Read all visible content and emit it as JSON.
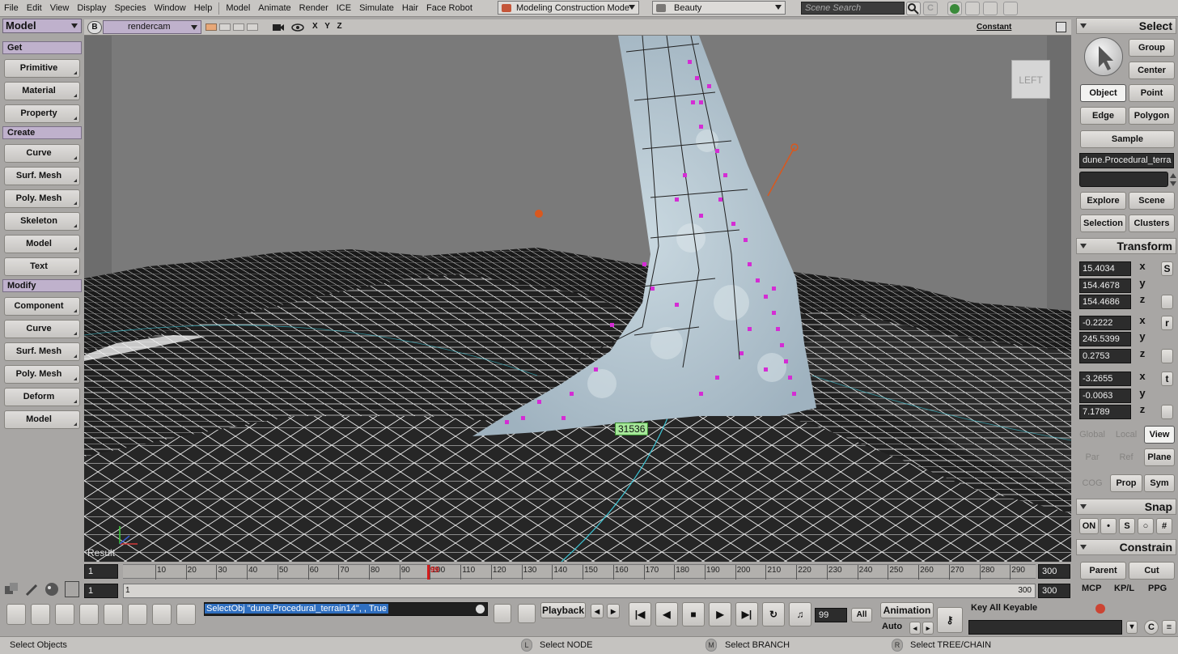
{
  "menubar": {
    "items": [
      "File",
      "Edit",
      "View",
      "Display",
      "Species",
      "Window",
      "Help"
    ],
    "modules": [
      "Model",
      "Animate",
      "Render",
      "ICE",
      "Simulate",
      "Hair",
      "Face Robot"
    ],
    "mode": "Modeling Construction Mode",
    "render_pass": "Beauty",
    "scene_search_placeholder": "Scene Search"
  },
  "left_panel": {
    "module": "Model",
    "sections": [
      {
        "title": "Get",
        "buttons": [
          "Primitive",
          "Material",
          "Property"
        ]
      },
      {
        "title": "Create",
        "buttons": [
          "Curve",
          "Surf. Mesh",
          "Poly. Mesh",
          "Skeleton",
          "Model",
          "Text"
        ]
      },
      {
        "title": "Modify",
        "buttons": [
          "Component",
          "Curve",
          "Surf. Mesh",
          "Poly. Mesh",
          "Deform",
          "Model"
        ]
      }
    ]
  },
  "viewport": {
    "badge": "B",
    "camera": "rendercam",
    "xyz": "X Y Z",
    "shading": "Constant",
    "view_cube": "LEFT",
    "point_count": "31536",
    "result_label": "Result",
    "colors": {
      "sky": "#777777",
      "mesh_bg": "#1a1a1a",
      "wire": "#ffffff",
      "particles": "#d42cd4",
      "cloud": "#b9cbd6",
      "light": "#d9581e"
    }
  },
  "right_panel": {
    "select_title": "Select",
    "select_buttons": [
      [
        "Group"
      ],
      [
        "Center"
      ],
      [
        "Object",
        "Point"
      ],
      [
        "Edge",
        "Polygon"
      ]
    ],
    "sample": "Sample",
    "object_name": "dune.Procedural_terra",
    "explore_buttons": [
      [
        "Explore",
        "Scene"
      ],
      [
        "Selection",
        "Clusters"
      ]
    ],
    "transform_title": "Transform",
    "transform": {
      "scale": [
        "15.4034",
        "154.4678",
        "154.4686"
      ],
      "rotate": [
        "-0.2222",
        "245.5399",
        "0.2753"
      ],
      "translate": [
        "-3.2655",
        "-0.0063",
        "7.1789"
      ],
      "axes": [
        "x",
        "y",
        "z"
      ],
      "srt": [
        "S",
        "r",
        "t"
      ]
    },
    "ref_buttons": [
      [
        "Global",
        "Local",
        "View"
      ],
      [
        "Par",
        "Ref",
        "Plane"
      ],
      [
        "COG",
        "Prop",
        "Sym"
      ]
    ],
    "snap_title": "Snap",
    "snap_on": "ON",
    "constrain_title": "Constrain",
    "constrain_buttons": [
      "Parent",
      "Cut"
    ],
    "tabs": [
      "MCP",
      "KP/L",
      "PPG"
    ]
  },
  "timeline": {
    "start": "1",
    "range_start": "1",
    "end": "300",
    "range_end_label": "300",
    "range_end": "300",
    "current_frame": "99",
    "ticks": [
      "10",
      "20",
      "30",
      "40",
      "50",
      "60",
      "70",
      "80",
      "90",
      "100",
      "110",
      "120",
      "130",
      "140",
      "150",
      "160",
      "170",
      "180",
      "190",
      "200",
      "210",
      "220",
      "230",
      "240",
      "250",
      "260",
      "270",
      "280",
      "290"
    ]
  },
  "bottom_bar": {
    "command": "SelectObj \"dune.Procedural_terrain14\", , True",
    "playback": "Playback",
    "frame": "99",
    "all": "All",
    "animation": "Animation",
    "auto": "Auto",
    "keyable": "Key All Keyable"
  },
  "statusbar": {
    "message": "Select Objects",
    "left_mouse": "L",
    "left_action": "Select NODE",
    "middle_mouse": "M",
    "middle_action": "Select BRANCH",
    "right_mouse": "R",
    "right_action": "Select TREE/CHAIN"
  }
}
